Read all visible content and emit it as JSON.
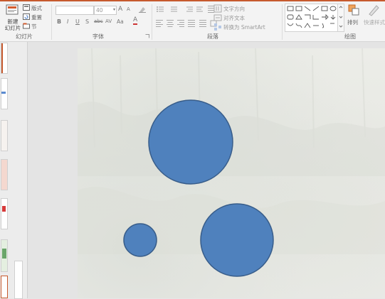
{
  "ribbon": {
    "slides_group": {
      "new_slide": "新建\n幻灯片",
      "layout": "版式",
      "reset": "重置",
      "section": "节",
      "label": "幻灯片"
    },
    "font_group": {
      "font_size": "40",
      "bold": "B",
      "italic": "I",
      "underline": "U",
      "strike": "S",
      "shadow": "abc",
      "spacing": "AV",
      "case": "Aa",
      "color": "A",
      "grow": "A",
      "shrink": "A",
      "label": "字体"
    },
    "paragraph_group": {
      "text_direction": "文字方向",
      "align_text": "对齐文本",
      "smartart": "转换为 SmartArt",
      "label": "段落"
    },
    "drawing_group": {
      "arrange": "排列",
      "quick_styles": "快速样式",
      "label": "绘图"
    }
  },
  "colors": {
    "accent": "#c65a2e",
    "shape_fill": "#4f81bd",
    "shape_stroke": "#385d8a"
  },
  "slide": {
    "shapes": [
      "circle",
      "circle",
      "circle"
    ]
  }
}
